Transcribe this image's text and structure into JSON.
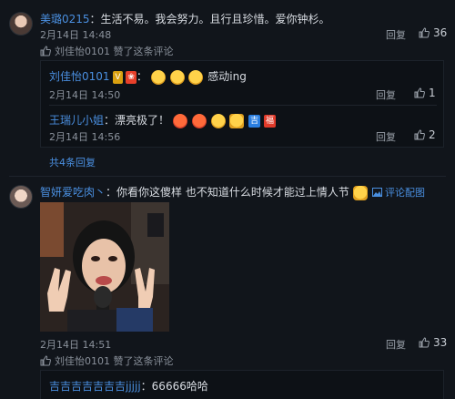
{
  "comments": [
    {
      "user": "美璐0215",
      "text": "：生活不易。我会努力。且行且珍惜。爱你钟杉。",
      "time": "2月14日 14:48",
      "reply_label": "回复",
      "likes": "36",
      "liked_by": "刘佳怡0101 赞了这条评论",
      "replies": [
        {
          "user": "刘佳怡0101",
          "text": "感动ing",
          "time": "2月14日 14:50",
          "reply_label": "回复",
          "likes": "1"
        },
        {
          "user": "王瑞儿小姐",
          "text": "：漂亮极了！",
          "time": "2月14日 14:56",
          "reply_label": "回复",
          "likes": "2"
        }
      ],
      "more_replies": "共4条回复"
    },
    {
      "user": "智妍爱吃肉丶",
      "text": "：你看你这傻样 也不知道什么时候才能过上情人节",
      "pic_link": "评论配图",
      "time": "2月14日 14:51",
      "reply_label": "回复",
      "likes": "33",
      "liked_by": "刘佳怡0101 赞了这条评论",
      "replies": [
        {
          "user": "吉吉吉吉吉吉吉jjjjj",
          "text": "：66666哈哈"
        }
      ]
    }
  ],
  "colors": {
    "link": "#4a8fe0",
    "bg": "#11151b"
  },
  "icons": {
    "like": "thumbs-up-icon",
    "liked_by": "thumbs-up-small-icon",
    "image": "image-icon"
  }
}
